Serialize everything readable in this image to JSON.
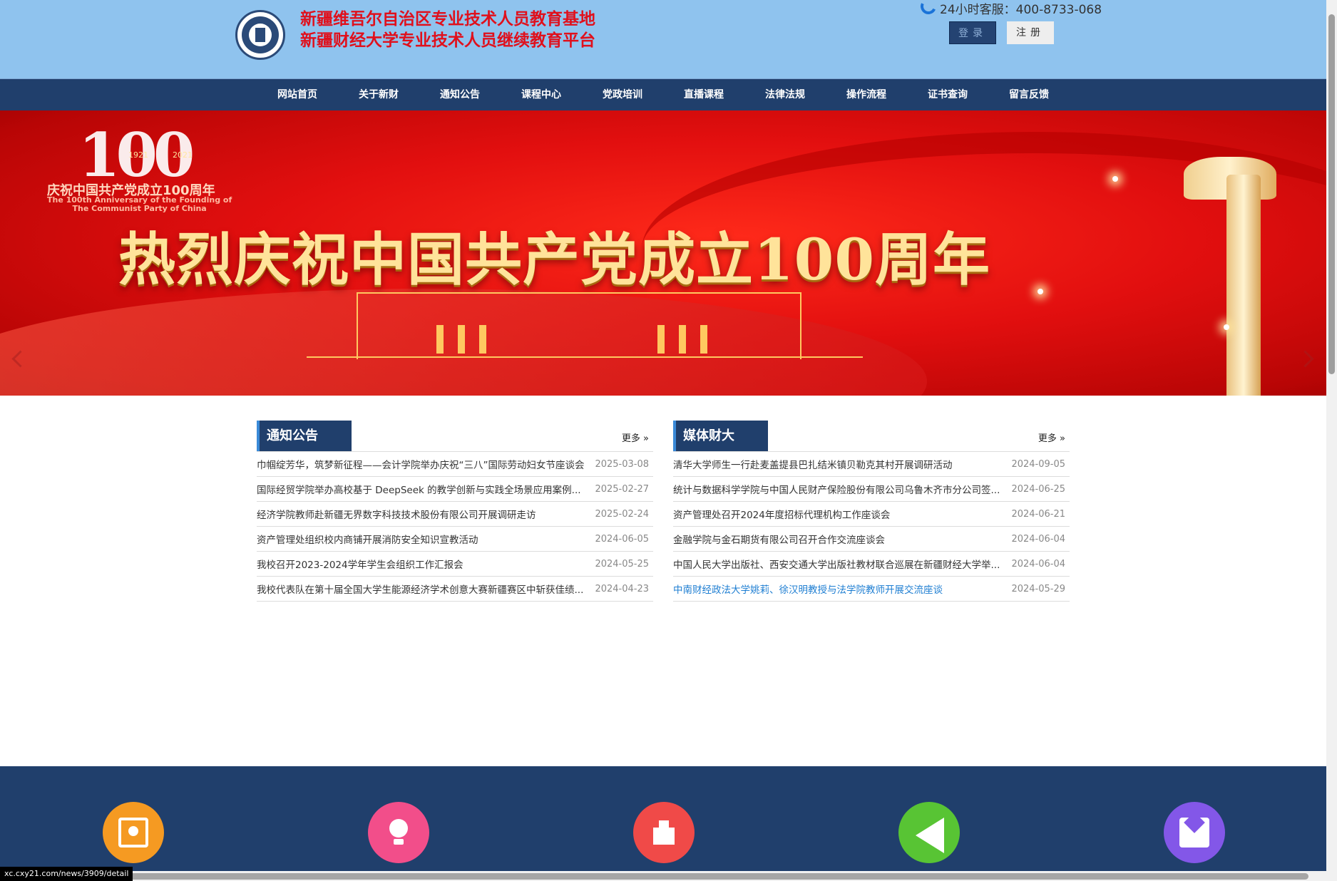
{
  "header": {
    "title_line1": "新疆维吾尔自治区专业技术人员教育基地",
    "title_line2": "新疆财经大学专业技术人员继续教育平台",
    "hotline": "24小时客服：400-8733-068",
    "login_label": "登录",
    "register_label": "注册"
  },
  "nav": {
    "items": [
      {
        "label": "网站首页"
      },
      {
        "label": "关于新财"
      },
      {
        "label": "通知公告"
      },
      {
        "label": "课程中心"
      },
      {
        "label": "党政培训"
      },
      {
        "label": "直播课程"
      },
      {
        "label": "法律法规"
      },
      {
        "label": "操作流程"
      },
      {
        "label": "证书查询"
      },
      {
        "label": "留言反馈"
      }
    ]
  },
  "banner": {
    "badge_number": "100",
    "year_start": "1921",
    "year_end": "2021",
    "anniv_cn": "庆祝中国共产党成立100周年",
    "anniv_en_line1": "The 100th Anniversary of the Founding of",
    "anniv_en_line2": "The Communist Party of China",
    "headline": "热烈庆祝中国共产党成立100周年",
    "slide_count": 4,
    "active_slide": 2
  },
  "notices": {
    "title": "通知公告",
    "more": "更多 »",
    "items": [
      {
        "title": "巾帼绽芳华，筑梦新征程——会计学院举办庆祝“三八”国际劳动妇女节座谈会",
        "date": "2025-03-08"
      },
      {
        "title": "国际经贸学院举办高校基于 DeepSeek 的教学创新与实践全场景应用案例...",
        "date": "2025-02-27"
      },
      {
        "title": "经济学院教师赴新疆无界数字科技技术股份有限公司开展调研走访",
        "date": "2025-02-24"
      },
      {
        "title": "资产管理处组织校内商铺开展消防安全知识宣教活动",
        "date": "2024-06-05"
      },
      {
        "title": "我校召开2023-2024学年学生会组织工作汇报会",
        "date": "2024-05-25"
      },
      {
        "title": "我校代表队在第十届全国大学生能源经济学术创意大赛新疆赛区中斩获佳绩...",
        "date": "2024-04-23"
      }
    ]
  },
  "media": {
    "title": "媒体财大",
    "more": "更多 »",
    "items": [
      {
        "title": "清华大学师生一行赴麦盖提县巴扎结米镇贝勒克其村开展调研活动",
        "date": "2024-09-05",
        "hovered": false
      },
      {
        "title": "统计与数据科学学院与中国人民财产保险股份有限公司乌鲁木齐市分公司签...",
        "date": "2024-06-25",
        "hovered": false
      },
      {
        "title": "资产管理处召开2024年度招标代理机构工作座谈会",
        "date": "2024-06-21",
        "hovered": false
      },
      {
        "title": "金融学院与金石期货有限公司召开合作交流座谈会",
        "date": "2024-06-04",
        "hovered": false
      },
      {
        "title": "中国人民大学出版社、西安交通大学出版社教材联合巡展在新疆财经大学举...",
        "date": "2024-06-04",
        "hovered": false
      },
      {
        "title": "中南财经政法大学姚莉、徐汉明教授与法学院教师开展交流座谈",
        "date": "2024-05-29",
        "hovered": true
      }
    ]
  },
  "footer": {
    "icons": [
      {
        "name": "portrait-icon",
        "color": "#f59a22"
      },
      {
        "name": "lightbulb-icon",
        "color": "#f24e8a"
      },
      {
        "name": "building-icon",
        "color": "#f04a48"
      },
      {
        "name": "play-icon",
        "color": "#58c434"
      },
      {
        "name": "mail-icon",
        "color": "#8357e8"
      }
    ]
  },
  "status_bar": {
    "url": "xc.cxy21.com/news/3909/detail"
  },
  "colors": {
    "header_bg": "#8fc3ee",
    "nav_bg": "#203f6c",
    "title_red": "#e0101c",
    "link_blue": "#1e7ed2"
  }
}
